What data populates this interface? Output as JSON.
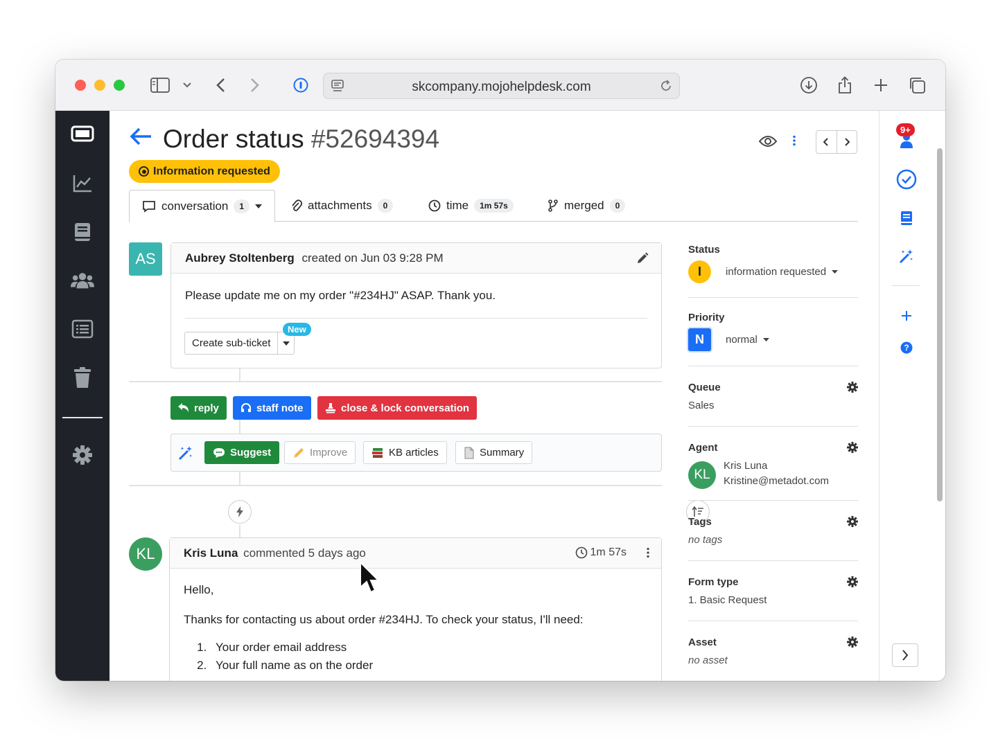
{
  "browser": {
    "url": "skcompany.mojohelpdesk.com"
  },
  "ticket": {
    "title": "Order status",
    "number": "#52694394",
    "status_pill": "Information requested"
  },
  "tabs": [
    {
      "label": "conversation",
      "badge": "1"
    },
    {
      "label": "attachments",
      "badge": "0"
    },
    {
      "label": "time",
      "badge": "1m 57s"
    },
    {
      "label": "merged",
      "badge": "0"
    }
  ],
  "first_message": {
    "avatar": "AS",
    "author": "Aubrey Stoltenberg",
    "meta": "created on Jun 03 9:28 PM",
    "body": "Please update me on my order \"#234HJ\" ASAP. Thank you.",
    "subticket_label": "Create sub-ticket",
    "new_badge": "New"
  },
  "actions": {
    "reply": "reply",
    "staff_note": "staff note",
    "close": "close & lock conversation"
  },
  "ai_tools": {
    "suggest": "Suggest",
    "improve": "Improve",
    "kb": "KB articles",
    "summary": "Summary"
  },
  "comment": {
    "avatar": "KL",
    "author": "Kris Luna",
    "meta": "commented 5 days ago",
    "timer": "1m 57s",
    "greeting": "Hello,",
    "line": "Thanks for contacting us about order #234HJ. To check your status, I'll need:",
    "list": [
      "Your order email address",
      "Your full name as on the order"
    ]
  },
  "details": {
    "status_label": "Status",
    "status_letter": "I",
    "status_value": "information requested",
    "priority_label": "Priority",
    "priority_letter": "N",
    "priority_value": "normal",
    "queue_label": "Queue",
    "queue_value": "Sales",
    "agent_label": "Agent",
    "agent_initials": "KL",
    "agent_name": "Kris Luna",
    "agent_email": "Kristine@metadot.com",
    "tags_label": "Tags",
    "tags_value": "no tags",
    "formtype_label": "Form type",
    "formtype_value": "1. Basic Request",
    "asset_label": "Asset",
    "asset_value": "no asset"
  },
  "rightrail": {
    "notif_count": "9+"
  },
  "colors": {
    "accent": "#1a6ef5",
    "status_yellow": "#ffc107",
    "reply_green": "#1f8a3c",
    "close_red": "#e23340",
    "sidebar_dark": "#1f2229"
  },
  "icons": [
    "back-arrow-icon",
    "eye-icon",
    "kebab-icon",
    "chevron-left-icon",
    "chevron-right-icon",
    "comment-icon",
    "paperclip-icon",
    "clock-icon",
    "branch-icon",
    "pencil-icon",
    "reply-icon",
    "headset-icon",
    "stamp-icon",
    "magic-wand-icon",
    "speech-bubble-icon",
    "pencil-icon",
    "books-icon",
    "document-icon",
    "bolt-icon",
    "sort-icon",
    "gear-icon",
    "user-icon",
    "check-circle-icon",
    "book-icon",
    "plus-icon",
    "question-icon"
  ]
}
